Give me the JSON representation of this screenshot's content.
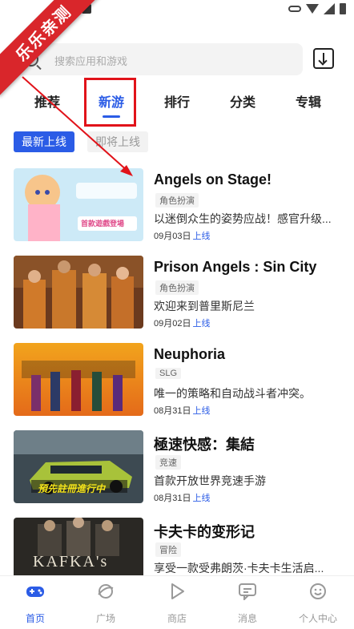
{
  "corner_badge": "乐乐亲测",
  "search": {
    "placeholder": "搜索应用和游戏"
  },
  "tabs": [
    {
      "label": "推荐"
    },
    {
      "label": "新游"
    },
    {
      "label": "排行"
    },
    {
      "label": "分类"
    },
    {
      "label": "专辑"
    }
  ],
  "active_tab": "新游",
  "sub_tabs": [
    {
      "label": "最新上线"
    },
    {
      "label": "即将上线"
    }
  ],
  "games": [
    {
      "title": "Angels on Stage!",
      "tag": "角色扮演",
      "desc": "以迷倒众生的姿势应战！感官升级...",
      "date": "09月03日",
      "status": "上线"
    },
    {
      "title": "Prison Angels : Sin City",
      "tag": "角色扮演",
      "desc": "欢迎来到普里斯尼兰",
      "date": "09月02日",
      "status": "上线"
    },
    {
      "title": "Neuphoria",
      "tag": "SLG",
      "desc": "唯一的策略和自动战斗者冲突。",
      "date": "08月31日",
      "status": "上线"
    },
    {
      "title": "極速快感：集結",
      "tag": "竞速",
      "desc": "首款开放世界竞速手游",
      "date": "08月31日",
      "status": "上线"
    },
    {
      "title": "卡夫卡的变形记",
      "tag": "冒险",
      "desc": "享受一款受弗朗茨·卡夫卡生活启...",
      "date": "",
      "status": ""
    }
  ],
  "thumb_text": {
    "angels_banner": "首款遊戲登場",
    "nfs_banner": "預先註冊進行中",
    "kafka": "KAFKA's"
  },
  "bottom_nav": [
    {
      "label": "首页",
      "icon": "gamepad-icon"
    },
    {
      "label": "广场",
      "icon": "planet-icon"
    },
    {
      "label": "商店",
      "icon": "play-icon"
    },
    {
      "label": "消息",
      "icon": "chat-icon"
    },
    {
      "label": "个人中心",
      "icon": "smile-icon"
    }
  ],
  "colors": {
    "accent": "#2b5ce6",
    "highlight_red": "#e1131a",
    "ribbon": "#d9262b"
  }
}
